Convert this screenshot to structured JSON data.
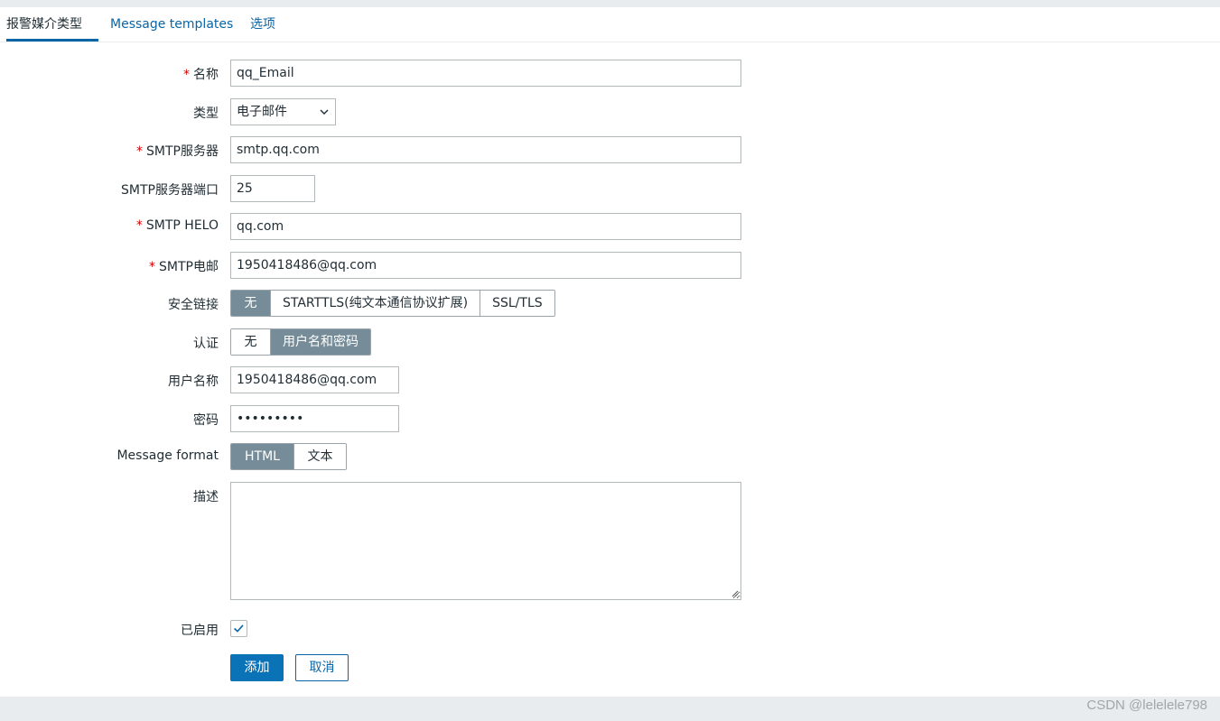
{
  "tabs": [
    {
      "label": "报警媒介类型",
      "active": true
    },
    {
      "label": "Message templates",
      "active": false
    },
    {
      "label": "选项",
      "active": false
    }
  ],
  "form": {
    "name": {
      "label": "名称",
      "required": true,
      "value": "qq_Email"
    },
    "type": {
      "label": "类型",
      "value": "电子邮件"
    },
    "smtp_server": {
      "label": "SMTP服务器",
      "required": true,
      "value": "smtp.qq.com"
    },
    "smtp_port": {
      "label": "SMTP服务器端口",
      "value": "25"
    },
    "smtp_helo": {
      "label": "SMTP HELO",
      "required": true,
      "value": "qq.com"
    },
    "smtp_email": {
      "label": "SMTP电邮",
      "required": true,
      "value": "1950418486@qq.com"
    },
    "security": {
      "label": "安全链接",
      "options": [
        "无",
        "STARTTLS(纯文本通信协议扩展)",
        "SSL/TLS"
      ],
      "selected": "无"
    },
    "auth": {
      "label": "认证",
      "options": [
        "无",
        "用户名和密码"
      ],
      "selected": "用户名和密码"
    },
    "username": {
      "label": "用户名称",
      "value": "1950418486@qq.com"
    },
    "password": {
      "label": "密码",
      "value": "•••••••••"
    },
    "message_format": {
      "label": "Message format",
      "options": [
        "HTML",
        "文本"
      ],
      "selected": "HTML"
    },
    "description": {
      "label": "描述",
      "value": ""
    },
    "enabled": {
      "label": "已启用",
      "checked": true
    },
    "required_marker": "*"
  },
  "actions": {
    "add_label": "添加",
    "cancel_label": "取消"
  },
  "watermark": "CSDN @lelelele798",
  "colors": {
    "accent": "#0a65a6",
    "segment_selected": "#768d99",
    "required": "#d40000"
  }
}
